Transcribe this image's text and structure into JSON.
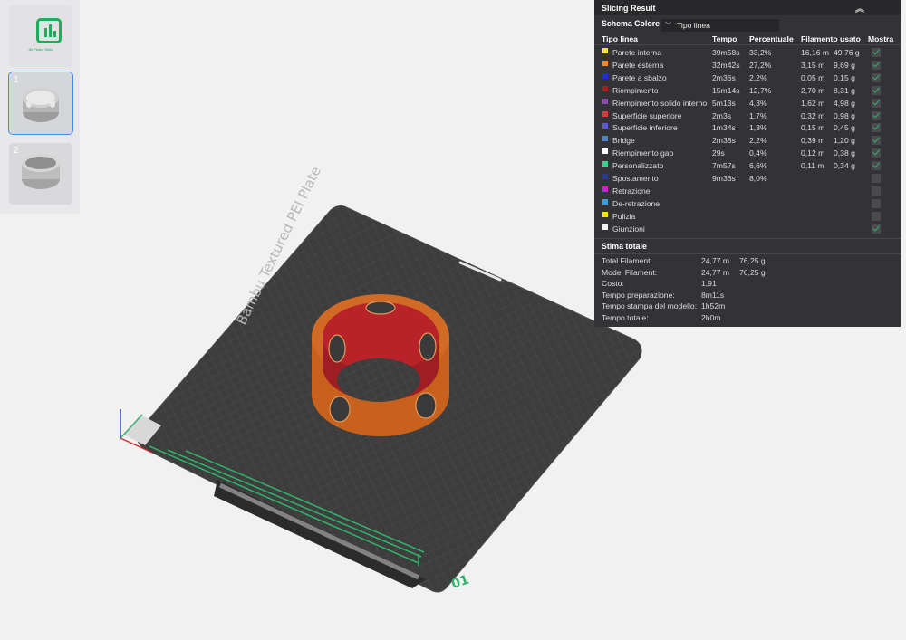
{
  "plate": {
    "brand_text": "Bambu Textured PEI Plate",
    "plate_number": "01"
  },
  "thumbnails": [
    {
      "label": "",
      "icon": "stats-icon",
      "caption": "All Plates Stats"
    },
    {
      "label": "1",
      "icon": "ring-object-icon",
      "selected": true
    },
    {
      "label": "2",
      "icon": "ring-object-icon",
      "selected": false
    }
  ],
  "panel": {
    "title": "Slicing Result",
    "scheme_label": "Schema Colore",
    "scheme_value": "Tipo linea",
    "columns": {
      "type": "Tipo linea",
      "time": "Tempo",
      "percent": "Percentuale",
      "filament": "Filamento usato",
      "show": "Mostra"
    },
    "rows": [
      {
        "name": "Parete interna",
        "color": "#f5e23a",
        "time": "39m58s",
        "percent": "33,2%",
        "length": "16,16 m",
        "weight": "49,76 g",
        "show": true
      },
      {
        "name": "Parete esterna",
        "color": "#f28a2b",
        "time": "32m42s",
        "percent": "27,2%",
        "length": "3,15 m",
        "weight": "9,69 g",
        "show": true
      },
      {
        "name": "Parete a sbalzo",
        "color": "#1d2fd8",
        "time": "2m36s",
        "percent": "2,2%",
        "length": "0,05 m",
        "weight": "0,15 g",
        "show": true
      },
      {
        "name": "Riempimento",
        "color": "#a81e1e",
        "time": "15m14s",
        "percent": "12,7%",
        "length": "2,70 m",
        "weight": "8,31 g",
        "show": true
      },
      {
        "name": "Riempimento solido interno",
        "color": "#8d4aa8",
        "time": "5m13s",
        "percent": "4,3%",
        "length": "1,62 m",
        "weight": "4,98 g",
        "show": true
      },
      {
        "name": "Superficie superiore",
        "color": "#d83a3a",
        "time": "2m3s",
        "percent": "1,7%",
        "length": "0,32 m",
        "weight": "0,98 g",
        "show": true
      },
      {
        "name": "Superficie inferiore",
        "color": "#5a5ad0",
        "time": "1m34s",
        "percent": "1,3%",
        "length": "0,15 m",
        "weight": "0,45 g",
        "show": true
      },
      {
        "name": "Bridge",
        "color": "#4f86c6",
        "time": "2m38s",
        "percent": "2,2%",
        "length": "0,39 m",
        "weight": "1,20 g",
        "show": true
      },
      {
        "name": "Riempimento gap",
        "color": "#ffffff",
        "time": "29s",
        "percent": "0,4%",
        "length": "0,12 m",
        "weight": "0,38 g",
        "show": true
      },
      {
        "name": "Personalizzato",
        "color": "#3fcf8e",
        "time": "7m57s",
        "percent": "6,6%",
        "length": "0,11 m",
        "weight": "0,34 g",
        "show": true
      },
      {
        "name": "Spostamento",
        "color": "#2a3a8c",
        "time": "9m36s",
        "percent": "8,0%",
        "length": "",
        "weight": "",
        "show": false
      },
      {
        "name": "Retrazione",
        "color": "#d21ed2",
        "time": "",
        "percent": "",
        "length": "",
        "weight": "",
        "show": false
      },
      {
        "name": "De-retrazione",
        "color": "#3aa0d8",
        "time": "",
        "percent": "",
        "length": "",
        "weight": "",
        "show": false
      },
      {
        "name": "Pulizia",
        "color": "#f5e500",
        "time": "",
        "percent": "",
        "length": "",
        "weight": "",
        "show": false
      },
      {
        "name": "Giunzioni",
        "color": "#f2f2f2",
        "time": "",
        "percent": "",
        "length": "",
        "weight": "",
        "show": true
      }
    ],
    "estimate": {
      "title": "Stima totale",
      "items": [
        {
          "label": "Total Filament:",
          "v1": "24,77 m",
          "v2": "76,25 g"
        },
        {
          "label": "Model Filament:",
          "v1": "24,77 m",
          "v2": "76,25 g"
        },
        {
          "label": "Costo:",
          "v1": "1,91",
          "v2": ""
        },
        {
          "label": "Tempo preparazione:",
          "v1": "8m11s",
          "v2": ""
        },
        {
          "label": "Tempo stampa del modello:",
          "v1": "1h52m",
          "v2": ""
        },
        {
          "label": "Tempo totale:",
          "v1": "2h0m",
          "v2": ""
        }
      ]
    }
  },
  "colors": {
    "accent": "#1fae5b",
    "selection": "#3a8ee6",
    "plate": "#3b3b3b",
    "model": "#c8601e",
    "model_inner": "#b8232a"
  }
}
